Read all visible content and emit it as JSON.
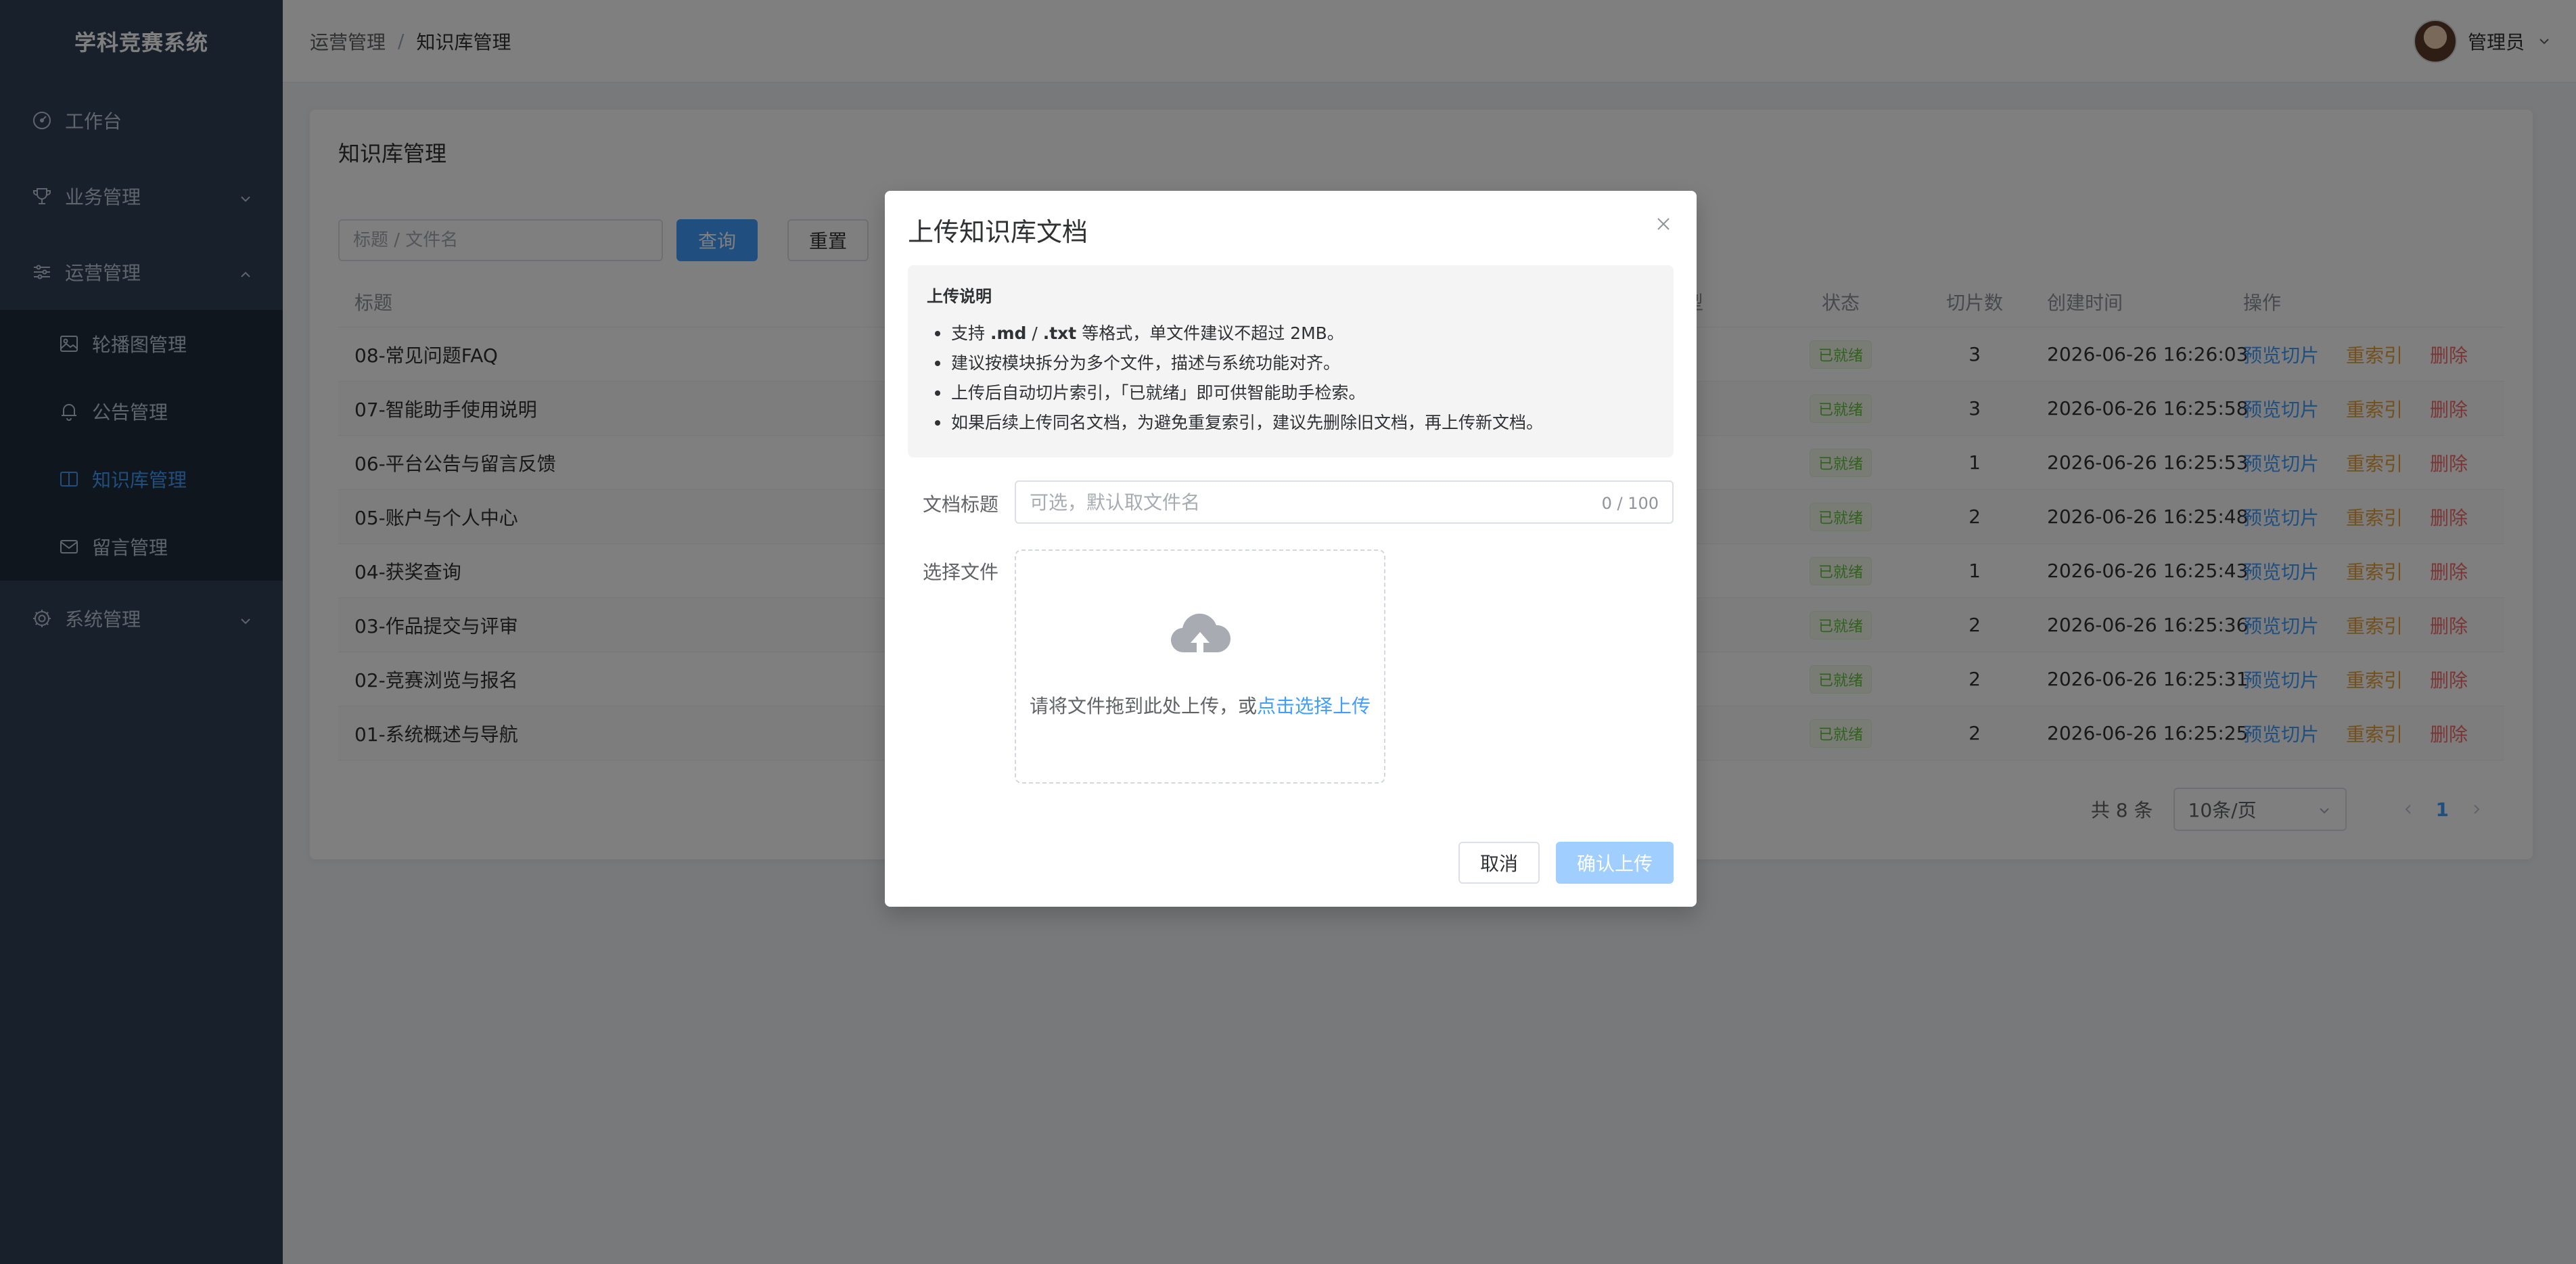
{
  "app": {
    "title": "学科竞赛系统"
  },
  "sidebar": {
    "items": [
      {
        "label": "工作台",
        "icon": "dashboard-icon"
      },
      {
        "label": "业务管理",
        "icon": "trophy-icon"
      },
      {
        "label": "运营管理",
        "icon": "sliders-icon"
      },
      {
        "label": "轮播图管理",
        "icon": "image-icon"
      },
      {
        "label": "公告管理",
        "icon": "bell-icon"
      },
      {
        "label": "知识库管理",
        "icon": "book-icon"
      },
      {
        "label": "留言管理",
        "icon": "mail-icon"
      },
      {
        "label": "系统管理",
        "icon": "gear-icon"
      }
    ],
    "active_label": "知识库管理"
  },
  "header": {
    "breadcrumb": [
      "运营管理",
      "知识库管理"
    ],
    "separator": "/",
    "username": "管理员"
  },
  "page": {
    "card_title": "知识库管理",
    "search_placeholder": "标题 / 文件名",
    "search_button": "查询",
    "reset_button": "重置"
  },
  "table": {
    "columns": {
      "title": "标题",
      "type": "型",
      "status": "状态",
      "chunks": "切片数",
      "created": "创建时间",
      "ops": "操作"
    },
    "rows": [
      {
        "title": "08-常见问题FAQ",
        "status": "已就绪",
        "chunks": "3",
        "created": "2026-06-26 16:26:03"
      },
      {
        "title": "07-智能助手使用说明",
        "status": "已就绪",
        "chunks": "3",
        "created": "2026-06-26 16:25:58"
      },
      {
        "title": "06-平台公告与留言反馈",
        "status": "已就绪",
        "chunks": "1",
        "created": "2026-06-26 16:25:53"
      },
      {
        "title": "05-账户与个人中心",
        "status": "已就绪",
        "chunks": "2",
        "created": "2026-06-26 16:25:48"
      },
      {
        "title": "04-获奖查询",
        "status": "已就绪",
        "chunks": "1",
        "created": "2026-06-26 16:25:43"
      },
      {
        "title": "03-作品提交与评审",
        "status": "已就绪",
        "chunks": "2",
        "created": "2026-06-26 16:25:36"
      },
      {
        "title": "02-竞赛浏览与报名",
        "status": "已就绪",
        "chunks": "2",
        "created": "2026-06-26 16:25:31"
      },
      {
        "title": "01-系统概述与导航",
        "status": "已就绪",
        "chunks": "2",
        "created": "2026-06-26 16:25:25"
      }
    ],
    "ops": {
      "preview": "预览切片",
      "reindex": "重索引",
      "delete": "删除"
    }
  },
  "pagination": {
    "total_text": "共 8 条",
    "page_size": "10条/页",
    "current_page": "1"
  },
  "dialog": {
    "title": "上传知识库文档",
    "tips_title": "上传说明",
    "tip1_pre": "支持 ",
    "tip1_bold1": ".md",
    "tip1_mid": " / ",
    "tip1_bold2": ".txt",
    "tip1_post": " 等格式，单文件建议不超过 2MB。",
    "tip2": "建议按模块拆分为多个文件，描述与系统功能对齐。",
    "tip3": "上传后自动切片索引，「已就绪」即可供智能助手检索。",
    "tip4": "如果后续上传同名文档，为避免重复索引，建议先删除旧文档，再上传新文档。",
    "doc_title_label": "文档标题",
    "doc_title_placeholder": "可选，默认取文件名",
    "doc_title_value": "",
    "word_count": "0 / 100",
    "file_label": "选择文件",
    "upload_text": "请将文件拖到此处上传，或",
    "upload_link": "点击选择上传",
    "cancel_button": "取消",
    "confirm_button": "确认上传"
  },
  "colors": {
    "sidebar_bg": "#304156",
    "primary": "#409eff",
    "success": "#67c23a",
    "warning": "#e6a23c",
    "danger": "#f56c6c"
  }
}
